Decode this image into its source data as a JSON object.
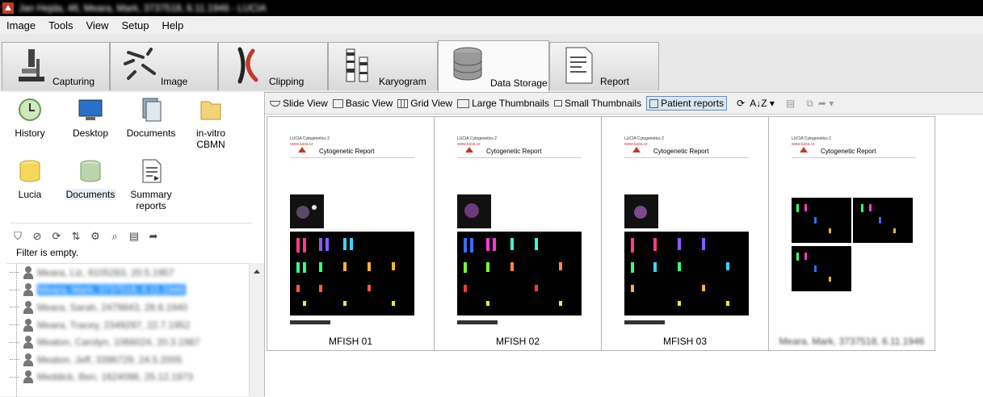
{
  "window": {
    "title": "Jan Hejda, 46, Meara, Mark, 3737518, 6.11.1946 - LUCIA"
  },
  "menu": [
    "Image",
    "Tools",
    "View",
    "Setup",
    "Help"
  ],
  "tabs": [
    {
      "label": "Capturing"
    },
    {
      "label": "Image"
    },
    {
      "label": "Clipping"
    },
    {
      "label": "Karyogram"
    },
    {
      "label": "Data Storage"
    },
    {
      "label": "Report"
    }
  ],
  "locations": [
    {
      "label": "History"
    },
    {
      "label": "Desktop"
    },
    {
      "label": "Documents"
    },
    {
      "label": "in-vitro CBMN"
    },
    {
      "label": "Lucia"
    },
    {
      "label": "Documents"
    },
    {
      "label": "Summary reports"
    }
  ],
  "filter_status": "Filter is empty.",
  "patients": [
    "Meara, Liz, 9105283, 20.5.1957",
    "Meara, Mark, 3737518, 6.11.1946",
    "Meara, Sarah, 2479843, 28.8.1940",
    "Meara, Tracey, 2349297, 22.7.1952",
    "Meaton, Carolyn, 1066024, 20.3.1987",
    "Meaton, Jeff, 3396729, 24.5.2005",
    "Meddick, Ben, 1624096, 25.12.1973"
  ],
  "view_modes": [
    {
      "label": "Slide View"
    },
    {
      "label": "Basic View"
    },
    {
      "label": "Grid View"
    },
    {
      "label": "Large Thumbnails"
    },
    {
      "label": "Small Thumbnails"
    },
    {
      "label": "Patient reports"
    }
  ],
  "report_page": {
    "company": "LUCIA Cytogenetics 2",
    "site": "www.lucia.cz",
    "title": "Cytogenetic Report"
  },
  "thumbnails": [
    {
      "caption": "MFISH 01"
    },
    {
      "caption": "MFISH 02"
    },
    {
      "caption": "MFISH 03"
    },
    {
      "caption": "Meara, Mark, 3737518, 6.11.1946"
    }
  ],
  "colors": {
    "accent": "#3399ff",
    "brand": "#c0392b",
    "titlebar": "#000000"
  }
}
